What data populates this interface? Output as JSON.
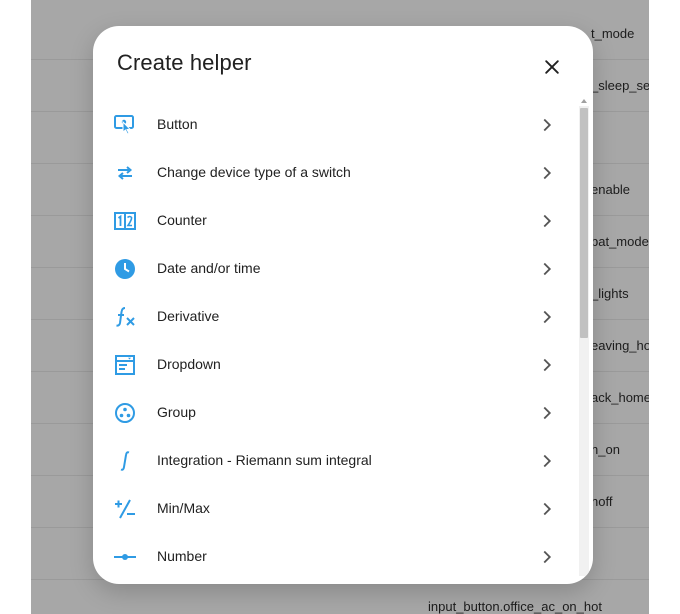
{
  "background": {
    "rows": [
      {
        "text": "t_mode"
      },
      {
        "text": "_sleep_set"
      },
      {
        "text": ""
      },
      {
        "text": "enable"
      },
      {
        "text": "bat_mode"
      },
      {
        "text": "_lights"
      },
      {
        "text": "eaving_ho"
      },
      {
        "text": "ack_home"
      },
      {
        "text": "n_on"
      },
      {
        "text": "noff"
      },
      {
        "text": ""
      },
      {
        "text": "input_button.office_ac_on_hot"
      }
    ]
  },
  "dialog": {
    "title": "Create helper",
    "close_icon": "close-icon",
    "items": [
      {
        "label": "Button",
        "icon": "gesture-tap-button-icon"
      },
      {
        "label": "Change device type of a switch",
        "icon": "swap-horizontal-icon"
      },
      {
        "label": "Counter",
        "icon": "counter-icon"
      },
      {
        "label": "Date and/or time",
        "icon": "clock-icon"
      },
      {
        "label": "Derivative",
        "icon": "function-variant-icon"
      },
      {
        "label": "Dropdown",
        "icon": "form-dropdown-icon"
      },
      {
        "label": "Group",
        "icon": "group-icon"
      },
      {
        "label": "Integration - Riemann sum integral",
        "icon": "integral-icon"
      },
      {
        "label": "Min/Max",
        "icon": "plus-minus-icon"
      },
      {
        "label": "Number",
        "icon": "ray-vertex-icon"
      }
    ]
  },
  "colors": {
    "icon": "#2f9be4",
    "overlay": "#a7a7a7",
    "text": "#212121"
  }
}
